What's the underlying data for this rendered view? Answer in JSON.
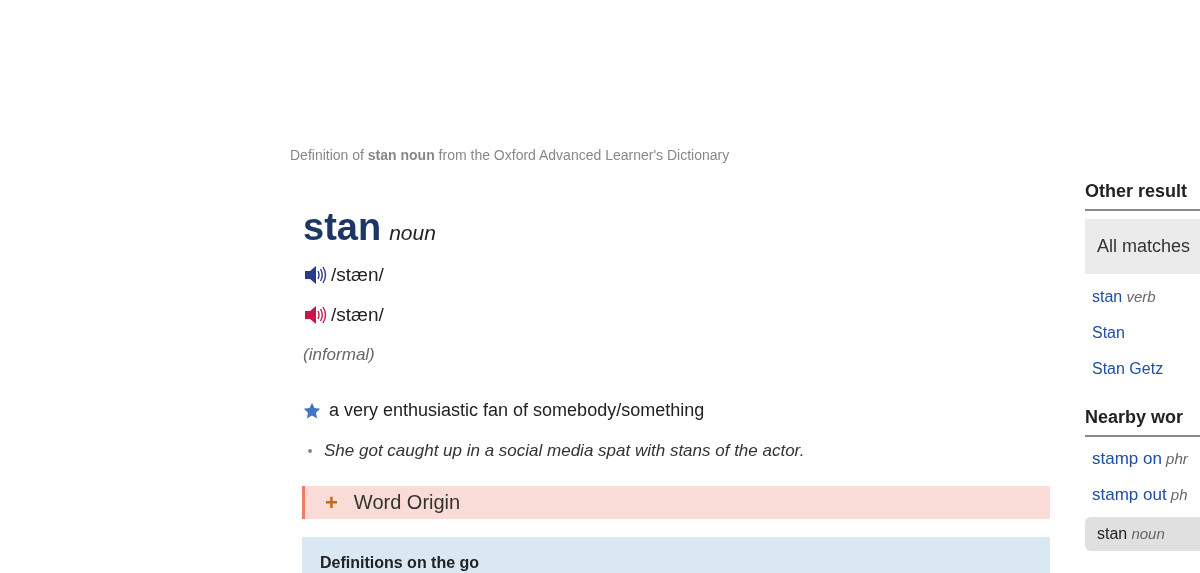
{
  "source_line": "Definition of **stan noun** from the Oxford Advanced Learner's Dictionary",
  "entry": {
    "headword": "stan",
    "pos": "noun",
    "pronunciations": [
      {
        "kind": "british",
        "ipa": "/stæn/"
      },
      {
        "kind": "american",
        "ipa": "/stæn/"
      }
    ],
    "label": "(informal)",
    "senses": [
      {
        "starred": true,
        "definition": "a very enthusiastic fan of somebody/something",
        "examples": [
          "She got caught up in a social media spat with stans of the actor."
        ]
      }
    ]
  },
  "word_origin": {
    "icon": "+",
    "label": "Word Origin",
    "expanded": false
  },
  "definitions_on_the_go": {
    "title": "Definitions on the go"
  },
  "sidebar": {
    "other_results": {
      "title": "Other result",
      "tab": "All matches",
      "items": [
        {
          "word": "stan",
          "pos": "verb"
        },
        {
          "word": "Stan"
        },
        {
          "word": "Stan Getz"
        }
      ]
    },
    "nearby_words": {
      "title": "Nearby wor",
      "items": [
        {
          "word": "stamp on",
          "pos": "phr",
          "selected": false
        },
        {
          "word": "stamp out",
          "pos": "ph",
          "selected": false
        },
        {
          "word": "stan",
          "pos": "noun",
          "selected": true
        }
      ]
    }
  }
}
